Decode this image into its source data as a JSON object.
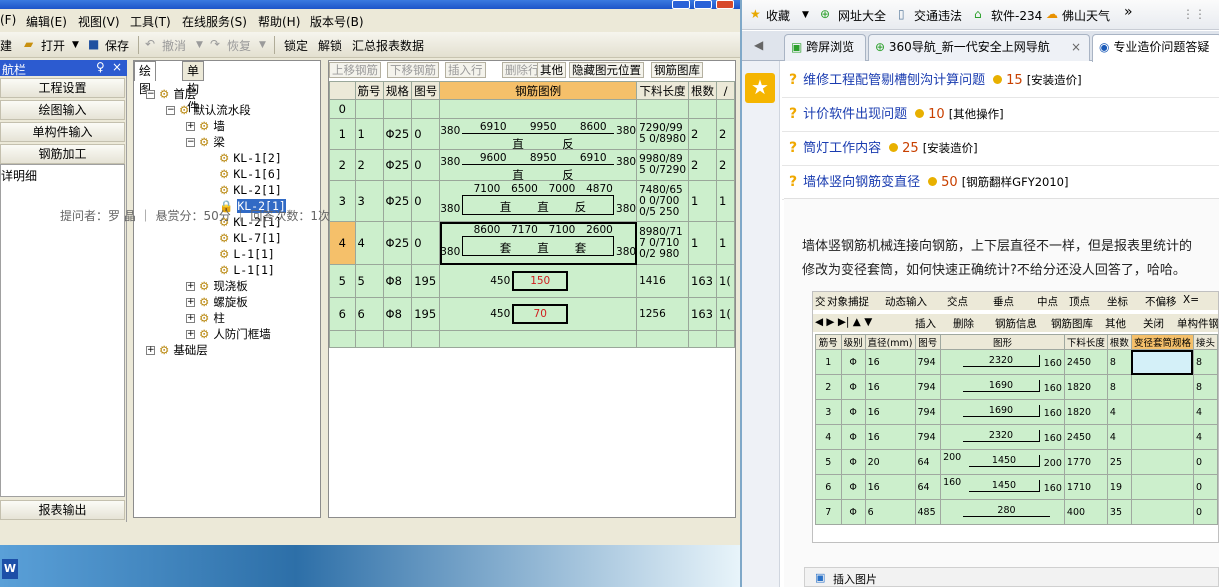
{
  "app": {
    "menu": [
      "(F)",
      "编辑(E)",
      "视图(V)",
      "工具(T)",
      "在线服务(S)",
      "帮助(H)",
      "版本号(B)"
    ],
    "toolbar": {
      "build": "建",
      "open": "打开",
      "save": "保存",
      "undo": "撤消",
      "redo": "恢复",
      "lock": "锁定",
      "unlock": "解锁",
      "summary": "汇总报表数据"
    },
    "nav": {
      "title": "航栏",
      "pin": "♀",
      "close": "×",
      "buttons": [
        "工程设置",
        "绘图输入",
        "单构件输入",
        "钢筋加工"
      ],
      "list_item": "详明细",
      "report": "报表输出"
    },
    "tree": {
      "tabs": [
        "绘图",
        "单构件"
      ],
      "nodes": [
        {
          "label": "首层",
          "expander": "⊟"
        },
        {
          "label": "默认流水段",
          "expander": "⊟"
        },
        {
          "label": "墙",
          "expander": "⊞"
        },
        {
          "label": "梁",
          "expander": "⊟"
        },
        {
          "label": "KL-1[2]"
        },
        {
          "label": "KL-1[6]"
        },
        {
          "label": "KL-2[1]"
        },
        {
          "label": "KL-2[1]",
          "selected": true
        },
        {
          "label": "KL-2[1]"
        },
        {
          "label": "KL-7[1]"
        },
        {
          "label": "L-1[1]"
        },
        {
          "label": "L-1[1]"
        },
        {
          "label": "现浇板",
          "expander": "⊞"
        },
        {
          "label": "螺旋板",
          "expander": "⊞"
        },
        {
          "label": "柱",
          "expander": "⊞"
        },
        {
          "label": "人防门框墙",
          "expander": "⊞"
        },
        {
          "label": "基础层",
          "expander": "⊞"
        }
      ]
    },
    "grid": {
      "buttons": [
        {
          "label": "上移钢筋",
          "disabled": true
        },
        {
          "label": "下移钢筋",
          "disabled": true
        },
        {
          "label": "插入行",
          "disabled": true
        },
        {
          "label": "删除行",
          "disabled": true
        },
        {
          "label": "其他",
          "disabled": false
        },
        {
          "label": "隐藏图元位置",
          "disabled": false
        },
        {
          "label": "钢筋图库",
          "disabled": false
        }
      ],
      "headers": [
        "筋号",
        "规格",
        "图号",
        "钢筋图例",
        "下料长度",
        "根数",
        "/"
      ],
      "rows": [
        {
          "rn": "0",
          "no": "",
          "spec": "",
          "fig": "",
          "len": "",
          "cnt": ""
        },
        {
          "rn": "1",
          "no": "1",
          "spec": "Φ25",
          "fig": "0",
          "len": "7290/995 0/8980",
          "cnt": "2",
          "extra": "2",
          "shape": {
            "left": "380",
            "right": "380",
            "segs": [
              "6910",
              "9950",
              "8600"
            ],
            "marks": [
              "直",
              "反"
            ]
          }
        },
        {
          "rn": "2",
          "no": "2",
          "spec": "Φ25",
          "fig": "0",
          "len": "9980/895 0/7290",
          "cnt": "2",
          "extra": "2",
          "shape": {
            "left": "380",
            "right": "380",
            "segs": [
              "9600",
              "8950",
              "6910"
            ],
            "marks": [
              "直",
              "反"
            ]
          }
        },
        {
          "rn": "3",
          "no": "3",
          "spec": "Φ25",
          "fig": "0",
          "len": "7480/650 0/7000/5 250",
          "cnt": "1",
          "extra": "1",
          "shape": {
            "left": "380",
            "right": "380",
            "segs": [
              "7100",
              "6500",
              "7000",
              "4870"
            ],
            "marks": [
              "直",
              "直",
              "反"
            ]
          }
        },
        {
          "rn": "4",
          "no": "4",
          "spec": "Φ25",
          "fig": "0",
          "len": "8980/717 0/7100/2 980",
          "cnt": "1",
          "extra": "1",
          "shape": {
            "left": "380",
            "right": "380",
            "segs": [
              "8600",
              "7170",
              "7100",
              "2600"
            ],
            "marks": [
              "套",
              "直",
              "套"
            ]
          }
        },
        {
          "rn": "5",
          "no": "5",
          "spec": "Φ8",
          "fig": "195",
          "len": "1416",
          "cnt": "163",
          "extra": "1(",
          "stirrup": {
            "left": "450",
            "inner": "150"
          }
        },
        {
          "rn": "6",
          "no": "6",
          "spec": "Φ8",
          "fig": "195",
          "len": "1256",
          "cnt": "163",
          "extra": "1(",
          "stirrup": {
            "left": "450",
            "inner": "70"
          }
        }
      ]
    }
  },
  "browser": {
    "toolbar": {
      "favorites": "收藏",
      "sites": "网址大全",
      "traffic": "交通违法",
      "software": "软件-234",
      "weather": "佛山天气",
      "more": "»"
    },
    "tabs": [
      "跨屏浏览",
      "360导航_新一代安全上网导航",
      "专业造价问题答疑"
    ],
    "questions": [
      {
        "title": "维修工程配管剔槽刨沟计算问题",
        "points": "15",
        "category": "[安装造价]"
      },
      {
        "title": "计价软件出现问题",
        "points": "10",
        "category": "[其他操作]"
      },
      {
        "title": "筒灯工作内容",
        "points": "25",
        "category": "[安装造价]"
      },
      {
        "title": "墙体竖向钢筋变直径",
        "points": "50",
        "category": "[钢筋翻样GFY2010]"
      }
    ],
    "meta": "提问者：罗 晶 ｜ 悬赏分：50分 ｜ 回答次数：1次",
    "body_line1": "墙体竖钢筋机械连接向钢筋，上下层直径不一样，但是报表里统计的",
    "body_line2": "修改为变径套筒，如何快速正确统计?不给分还没人回答了，哈哈。",
    "embedded": {
      "toolbar1": [
        "交",
        "对象捕捉",
        "动态输入",
        "交点",
        "垂点",
        "中点",
        "顶点",
        "坐标",
        "不偏移",
        "X="
      ],
      "toolbar2": [
        "插入",
        "删除",
        "钢筋信息",
        "钢筋图库",
        "其他",
        "关闭",
        "单构件钢筋"
      ],
      "headers": [
        "筋号",
        "级别",
        "直径(mm)",
        "图号",
        "图形",
        "下料长度",
        "根数",
        "变径套筒规格",
        "接头"
      ],
      "rows": [
        {
          "n": "1",
          "g": "Φ",
          "d": "16",
          "f": "794",
          "shape": "2320",
          "r": "160",
          "len": "2450",
          "cnt": "8",
          "j": "8"
        },
        {
          "n": "2",
          "g": "Φ",
          "d": "16",
          "f": "794",
          "shape": "1690",
          "r": "160",
          "len": "1820",
          "cnt": "8",
          "j": "8"
        },
        {
          "n": "3",
          "g": "Φ",
          "d": "16",
          "f": "794",
          "shape": "1690",
          "r": "160",
          "len": "1820",
          "cnt": "4",
          "j": "4"
        },
        {
          "n": "4",
          "g": "Φ",
          "d": "16",
          "f": "794",
          "shape": "2320",
          "r": "160",
          "len": "2450",
          "cnt": "4",
          "j": "4"
        },
        {
          "n": "5",
          "g": "Φ",
          "d": "20",
          "f": "64",
          "shape": "1450",
          "l": "200",
          "r": "200",
          "len": "1770",
          "cnt": "25",
          "j": "0"
        },
        {
          "n": "6",
          "g": "Φ",
          "d": "16",
          "f": "64",
          "shape": "1450",
          "l": "160",
          "r": "160",
          "len": "1710",
          "cnt": "19",
          "j": "0"
        },
        {
          "n": "7",
          "g": "Φ",
          "d": "6",
          "f": "485",
          "shape": "280",
          "len": "400",
          "cnt": "35",
          "j": "0"
        }
      ]
    },
    "footer": "插入图片"
  },
  "colors": {
    "grid_row": "#ccefcc",
    "header_highlight": "#f5c06a",
    "link": "#1a3cb0",
    "points": "#c84000"
  }
}
